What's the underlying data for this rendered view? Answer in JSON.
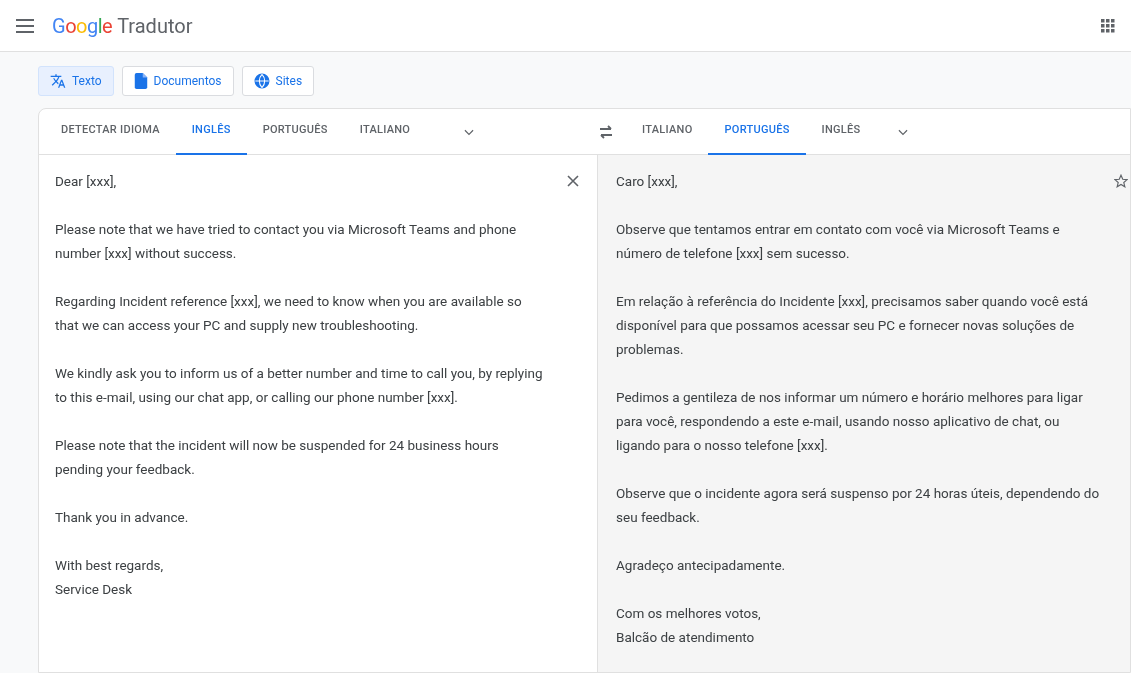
{
  "header": {
    "logo": "Google",
    "title": "Tradutor"
  },
  "modes": [
    {
      "label": "Texto",
      "kind": "text",
      "selected": true
    },
    {
      "label": "Documentos",
      "kind": "document",
      "selected": false
    },
    {
      "label": "Sites",
      "kind": "globe",
      "selected": false
    }
  ],
  "source_languages": [
    {
      "label": "DETECTAR IDIOMA",
      "selected": false
    },
    {
      "label": "INGLÊS",
      "selected": true
    },
    {
      "label": "PORTUGUÊS",
      "selected": false
    },
    {
      "label": "ITALIANO",
      "selected": false
    }
  ],
  "target_languages": [
    {
      "label": "ITALIANO",
      "selected": false
    },
    {
      "label": "PORTUGUÊS",
      "selected": true
    },
    {
      "label": "INGLÊS",
      "selected": false
    }
  ],
  "source_text": [
    "Dear [xxx],",
    "Please note that we have tried to contact you via Microsoft Teams and phone number [xxx] without success.",
    "Regarding Incident reference [xxx], we need to know when you are available so that we can access your PC and supply new troubleshooting.",
    "We kindly ask you to inform us of a better number and time to call you, by replying to this e-mail, using our chat app, or calling our phone number [xxx].",
    "Please note that the incident will now be suspended for 24 business hours pending your feedback.",
    "Thank you in advance.",
    "With best regards,\nService Desk"
  ],
  "translation": [
    "Caro [xxx],",
    "Observe que tentamos entrar em contato com você via Microsoft Teams e número de telefone [xxx] sem sucesso.",
    "Em relação à referência do Incidente [xxx], precisamos saber quando você está disponível para que possamos acessar seu PC e fornecer novas soluções de problemas.",
    "Pedimos a gentileza de nos informar um número e horário melhores para ligar para você, respondendo a este e-mail, usando nosso aplicativo de chat, ou ligando para o nosso telefone [xxx].",
    "Observe que o incidente agora será suspenso por 24 horas úteis, dependendo do seu feedback.",
    "Agradeço antecipadamente.",
    "Com os melhores votos,\nBalcão de atendimento"
  ]
}
